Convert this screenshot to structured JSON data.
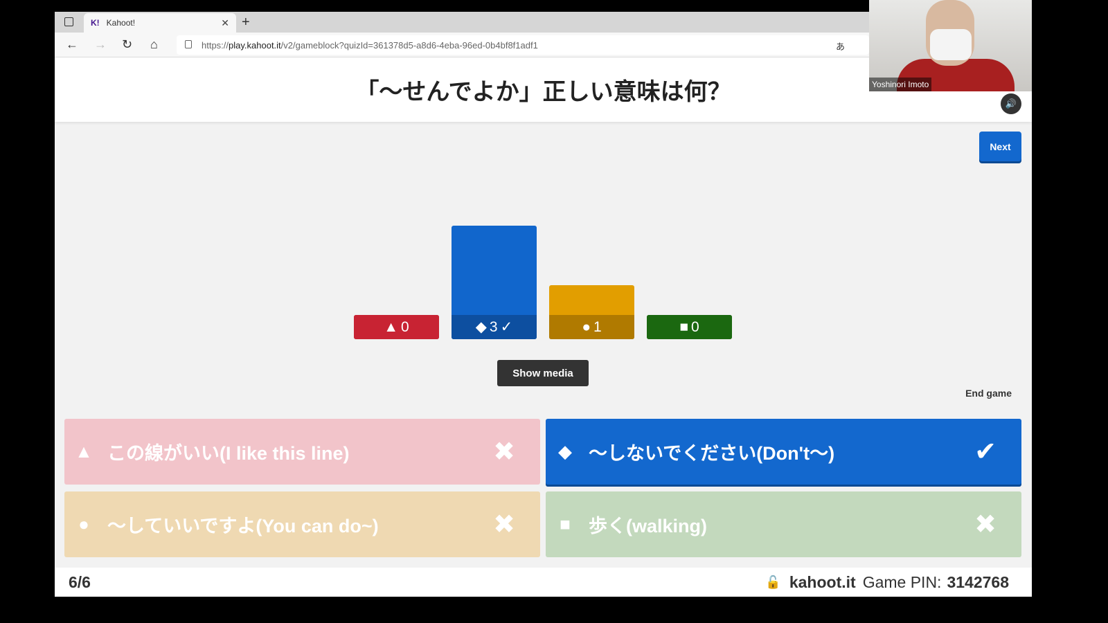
{
  "browser": {
    "tab_title": "Kahoot!",
    "url_prefix": "https://",
    "url_host": "play.kahoot.it",
    "url_path": "/v2/gameblock?quizId=361378d5-a8d6-4eba-96ed-0b4bf8f1adf1"
  },
  "question": "「～せんでよか」正しい意味は何？",
  "next_label": "Next",
  "show_media_label": "Show media",
  "end_game_label": "End game",
  "results": [
    {
      "shape": "triangle",
      "symbol": "▲",
      "count": 0,
      "color": "#c82333",
      "correct": false
    },
    {
      "shape": "diamond",
      "symbol": "◆",
      "count": 3,
      "color": "#1166cc",
      "label_color": "#0d4fa0",
      "correct": true,
      "check": "✓"
    },
    {
      "shape": "circle",
      "symbol": "●",
      "count": 1,
      "color": "#e29e00",
      "label_color": "#b07a00",
      "correct": false
    },
    {
      "shape": "square",
      "symbol": "■",
      "count": 0,
      "color": "#1b6810",
      "correct": false
    }
  ],
  "answers": [
    {
      "symbol": "▲",
      "text": "この線がいい(I like this line)",
      "color": "#f2c4ca",
      "mark": "✖"
    },
    {
      "symbol": "◆",
      "text": "～しないでください(Don't～)",
      "color": "#1368ce",
      "mark": "✔"
    },
    {
      "symbol": "●",
      "text": "～していいですよ(You can do~)",
      "color": "#efd9b2",
      "mark": "✖"
    },
    {
      "symbol": "■",
      "text": "歩く(walking)",
      "color": "#c3d9bd",
      "mark": "✖"
    }
  ],
  "footer": {
    "progress": "6/6",
    "site": "kahoot.it",
    "pin_label": "Game PIN:",
    "pin": "3142768"
  },
  "webcam": {
    "name": "Yoshinori Imoto"
  }
}
